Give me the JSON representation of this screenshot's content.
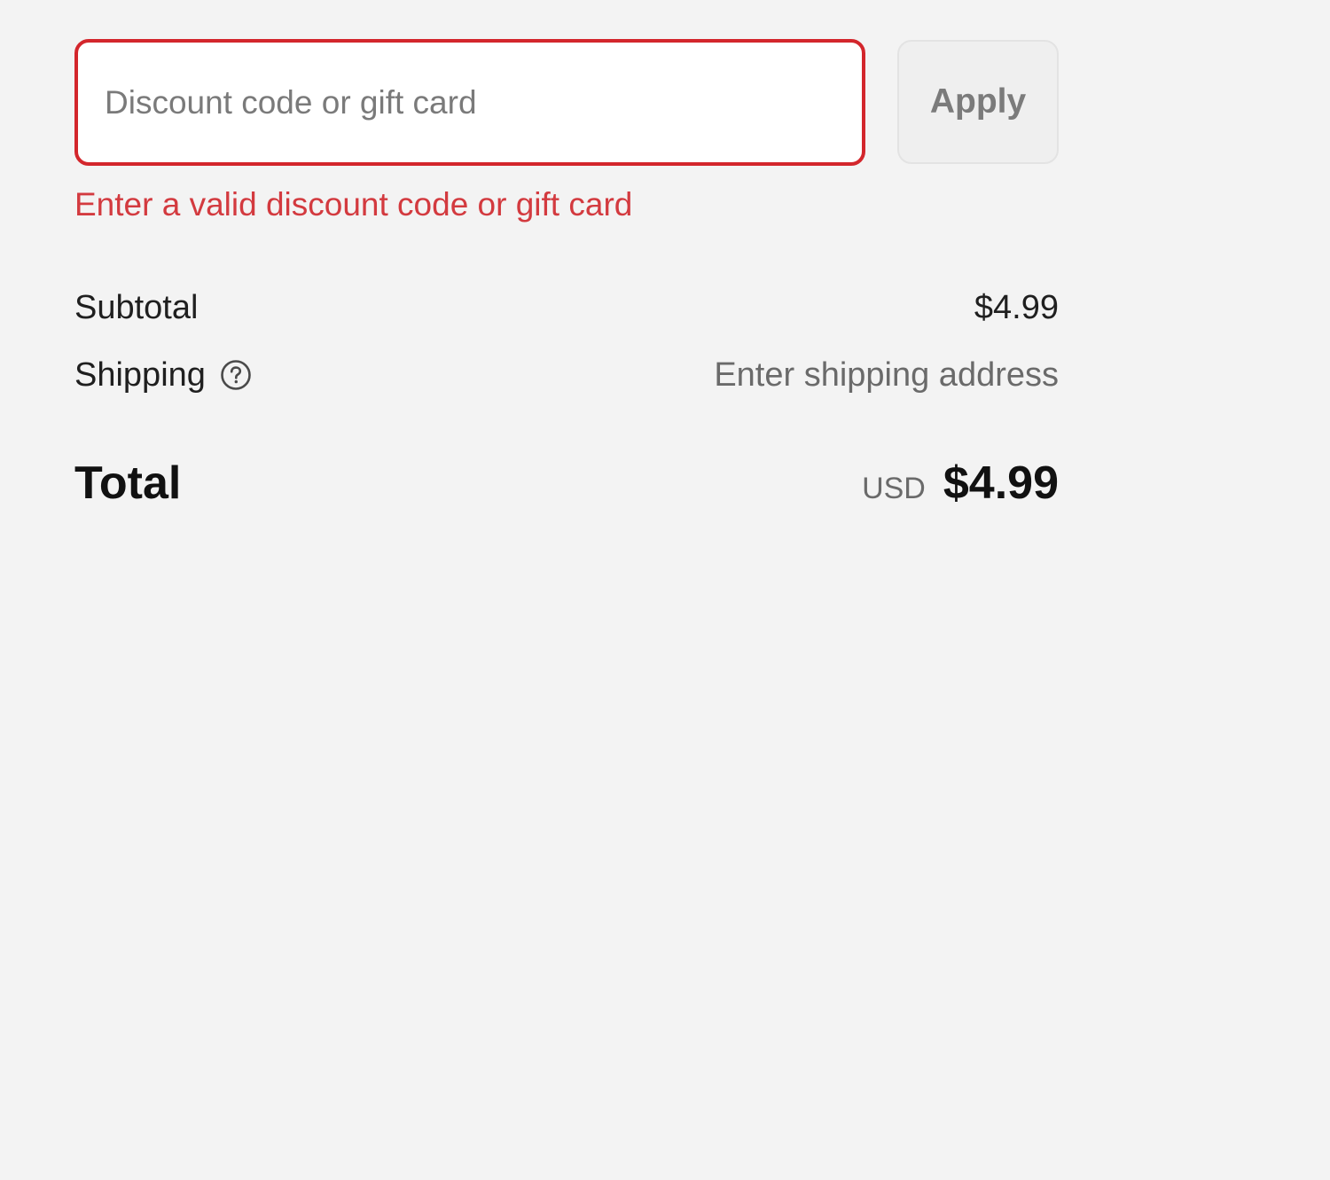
{
  "discount": {
    "placeholder": "Discount code or gift card",
    "value": "",
    "apply_label": "Apply",
    "error": "Enter a valid discount code or gift card",
    "error_color": "#d3262c"
  },
  "summary": {
    "subtotal_label": "Subtotal",
    "subtotal_value": "$4.99",
    "shipping_label": "Shipping",
    "shipping_help_icon": "question-circle-icon",
    "shipping_value": "Enter shipping address",
    "total_label": "Total",
    "total_currency": "USD",
    "total_value": "$4.99"
  }
}
